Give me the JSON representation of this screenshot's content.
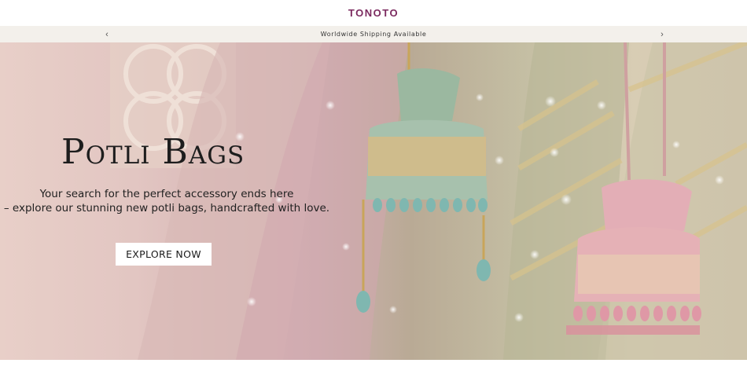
{
  "header": {
    "logo": "TONOTO"
  },
  "announcement": {
    "text": "Worldwide Shipping Available",
    "prev_icon": "‹",
    "next_icon": "›"
  },
  "hero": {
    "title": "Potli Bags",
    "subtitle_line1": "Your search for the perfect accessory ends here",
    "subtitle_line2": "– explore our stunning new potli bags, handcrafted with love.",
    "cta_label": "EXPLORE NOW",
    "image": "potli-bags-hero-image"
  },
  "colors": {
    "brand": "#7b2a5f",
    "announcement_bg": "#f3f0eb",
    "cta_bg": "#ffffff"
  }
}
